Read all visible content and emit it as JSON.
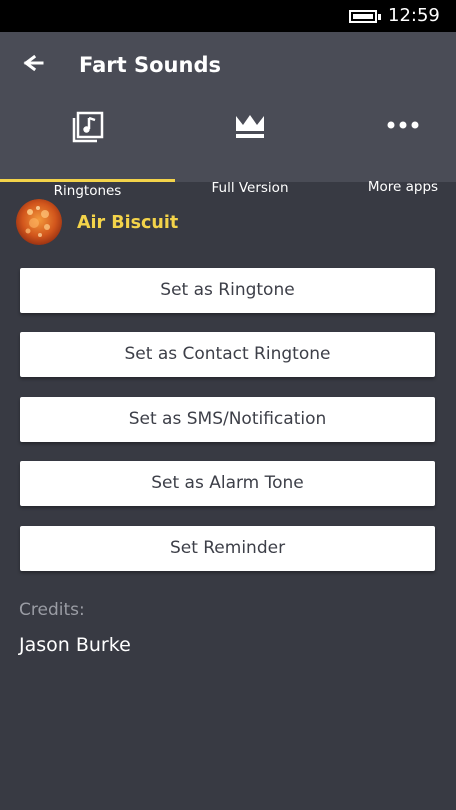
{
  "status_bar": {
    "time": "12:59",
    "battery_icon": "battery-full-icon"
  },
  "header": {
    "title": "Fart Sounds",
    "back_icon": "back-arrow-icon"
  },
  "tabs": [
    {
      "label": "Ringtones",
      "icon": "music-library-icon",
      "selected": true
    },
    {
      "label": "Full Version",
      "icon": "crown-icon",
      "selected": false
    },
    {
      "label": "More apps",
      "icon": "more-dots-icon",
      "selected": false
    }
  ],
  "sound": {
    "title": "Air Biscuit"
  },
  "actions": [
    "Set as Ringtone",
    "Set as Contact Ringtone",
    "Set as SMS/Notification",
    "Set as Alarm Tone",
    "Set Reminder"
  ],
  "credits": {
    "label": "Credits:",
    "name": "Jason Burke"
  },
  "colors": {
    "accent": "#f3d34a",
    "header_bg": "#4a4c56",
    "page_bg": "#383a43"
  }
}
